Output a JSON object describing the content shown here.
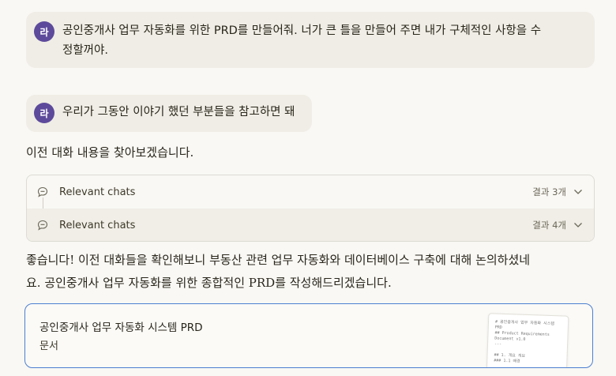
{
  "messages": [
    {
      "avatar": "라",
      "text_line1": "공인중개사 업무 자동화를 위한 PRD를 만들어줘. 너가 큰 틀을 만들어 주면 내가 구체적인 사항을 수",
      "text_line2": "정할꺼야."
    },
    {
      "avatar": "라",
      "text": "우리가 그동안 이야기 했던 부분들을 참고하면 돼"
    }
  ],
  "reply1": "이전 대화 내용을 찾아보겠습니다.",
  "chats": [
    {
      "label": "Relevant chats",
      "count": "결과 3개"
    },
    {
      "label": "Relevant chats",
      "count": "결과 4개"
    }
  ],
  "reply2_line1": "좋습니다! 이전 대화들을 확인해보니 부동산 관련 업무 자동화와 데이터베이스 구축에 대해 논의하셨네",
  "reply2_line2": "요. 공인중개사 업무 자동화를 위한 종합적인 PRD를 작성해드리겠습니다.",
  "artifact": {
    "title": "공인중개사 업무 자동화 시스템 PRD",
    "type": "문서",
    "preview_lines": [
      "# 공인중개사 업무 자동화 시스템",
      "PRD",
      "## Product Requirements",
      "Document v1.0",
      "---",
      "",
      "## 1. 개요 개요",
      "### 1.1 배경"
    ]
  },
  "colors": {
    "avatar": "#5d4a9b",
    "user_bubble": "#efede5",
    "artifact_border": "#4c7fd0",
    "page_bg": "#f9f8f4"
  }
}
